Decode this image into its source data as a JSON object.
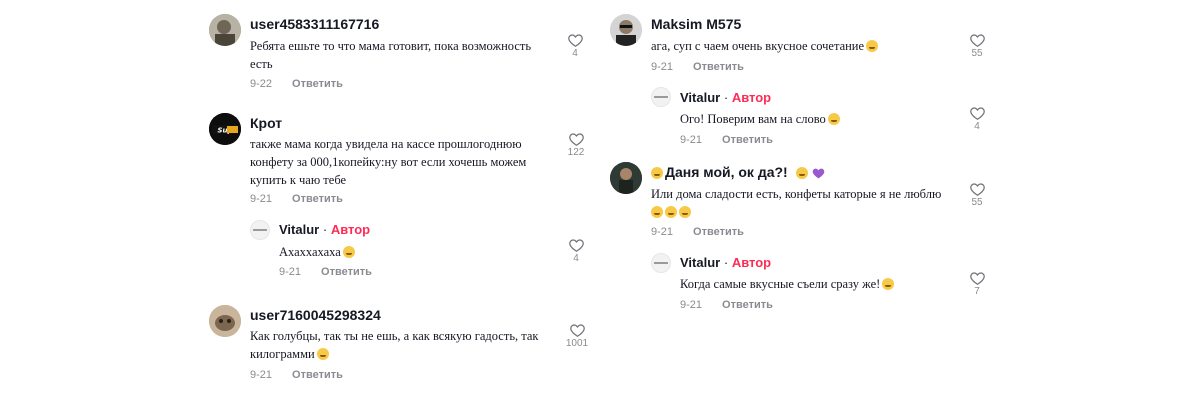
{
  "comments": [
    {
      "username": "user4583311167716",
      "text": "Ребята ешьте то что мама готовит, пока возможность есть",
      "date": "9-22",
      "reply_label": "Ответить",
      "likes": "4"
    },
    {
      "username": "Крот",
      "avatar_text": "Supreme",
      "text": "также мама когда увидела на кассе прошлогоднюю конфету за 000,1копейку:ну вот если хочешь можем купить к чаю тебе",
      "date": "9-21",
      "reply_label": "Ответить",
      "likes": "122",
      "reply": {
        "username": "Vitalur",
        "author_label": "Автор",
        "text": "Ахаххахаха",
        "date": "9-21",
        "reply_label": "Ответить",
        "likes": "4"
      }
    },
    {
      "username": "user7160045298324",
      "text": "Как голубцы, так ты не ешь, а как всякую гадость, так килограмми",
      "date": "9-21",
      "reply_label": "Ответить",
      "likes": "1001"
    },
    {
      "username": "Maksim M575",
      "text": "ага, суп с чаем очень вкусное сочетание",
      "date": "9-21",
      "reply_label": "Ответить",
      "likes": "55",
      "reply": {
        "username": "Vitalur",
        "author_label": "Автор",
        "text": "Ого! Поверим вам на слово",
        "date": "9-21",
        "reply_label": "Ответить",
        "likes": "4"
      }
    },
    {
      "username": "Даня мой, ок да?!",
      "text": "Или дома сладости есть, конфеты каторые я не люблю",
      "date": "9-21",
      "reply_label": "Ответить",
      "likes": "55",
      "reply": {
        "username": "Vitalur",
        "author_label": "Автор",
        "text": "Когда самые вкусные съели сразу же!",
        "date": "9-21",
        "reply_label": "Ответить",
        "likes": "7"
      }
    }
  ],
  "separator": "·",
  "colors": {
    "author": "#fe2c55",
    "meta": "#8a8b91",
    "text": "#161823"
  },
  "icons": {
    "like": "heart-outline-icon"
  }
}
